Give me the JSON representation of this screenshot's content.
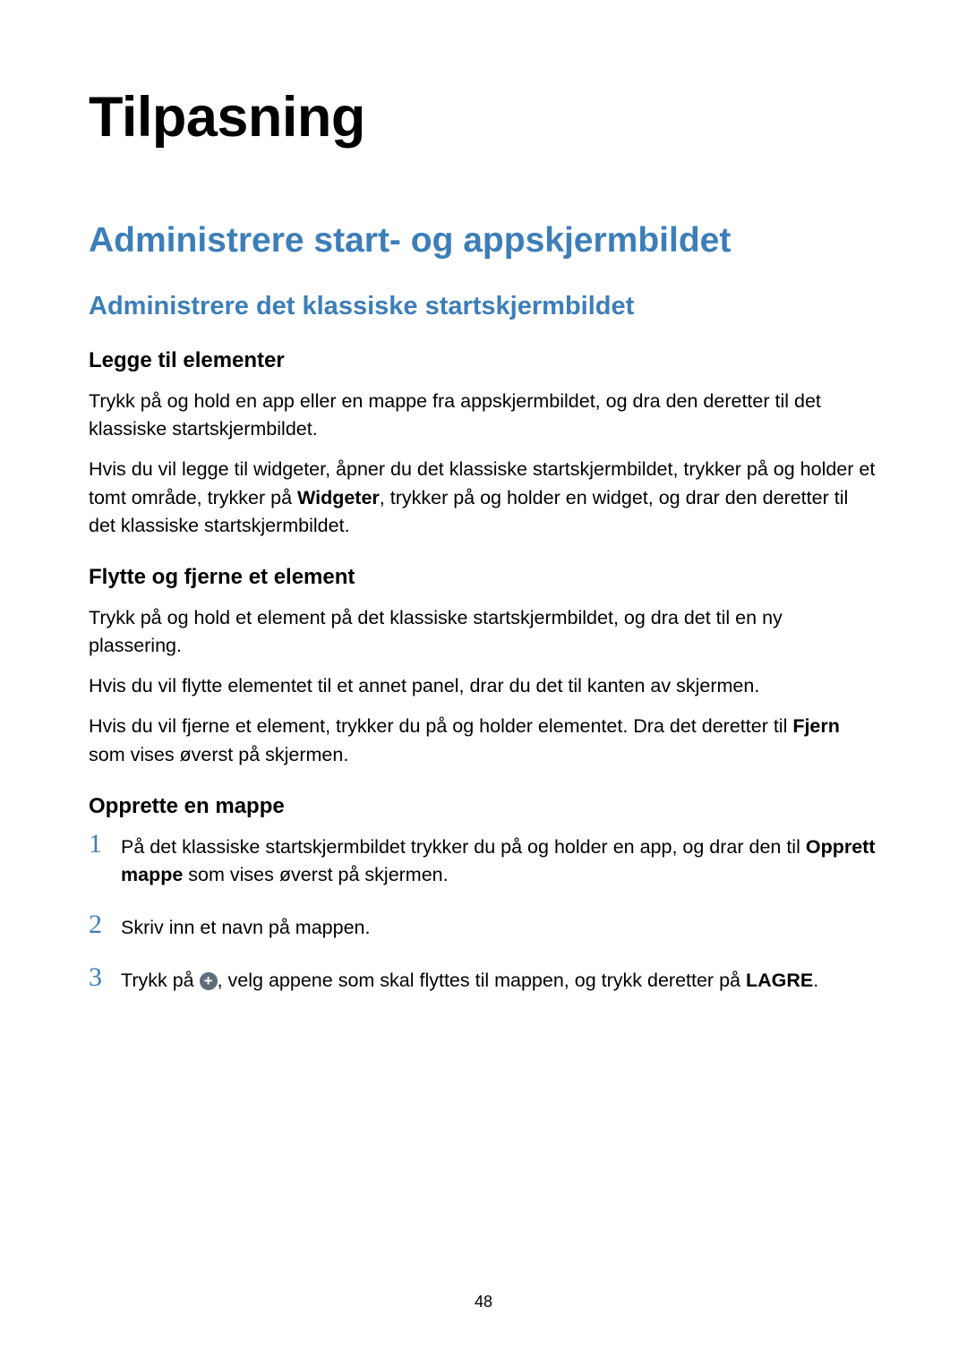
{
  "page": {
    "h1": "Tilpasning",
    "h2": "Administrere start- og appskjermbildet",
    "h3": "Administrere det klassiske startskjermbildet",
    "section1": {
      "h4": "Legge til elementer",
      "p1": "Trykk på og hold en app eller en mappe fra appskjermbildet, og dra den deretter til det klassiske startskjermbildet.",
      "p2a": "Hvis du vil legge til widgeter, åpner du det klassiske startskjermbildet, trykker på og holder et tomt område, trykker på ",
      "p2bold": "Widgeter",
      "p2b": ", trykker på og holder en widget, og drar den deretter til det klassiske startskjermbildet."
    },
    "section2": {
      "h4": "Flytte og fjerne et element",
      "p1": "Trykk på og hold et element på det klassiske startskjermbildet, og dra det til en ny plassering.",
      "p2": "Hvis du vil flytte elementet til et annet panel, drar du det til kanten av skjermen.",
      "p3a": "Hvis du vil fjerne et element, trykker du på og holder elementet. Dra det deretter til ",
      "p3bold": "Fjern",
      "p3b": " som vises øverst på skjermen."
    },
    "section3": {
      "h4": "Opprette en mappe",
      "step1_num": "1",
      "step1a": "På det klassiske startskjermbildet trykker du på og holder en app, og drar den til ",
      "step1bold": "Opprett mappe",
      "step1b": " som vises øverst på skjermen.",
      "step2_num": "2",
      "step2": "Skriv inn et navn på mappen.",
      "step3_num": "3",
      "step3a": "Trykk på ",
      "step3b": ", velg appene som skal flyttes til mappen, og trykk deretter på ",
      "step3bold": "LAGRE",
      "step3c": "."
    },
    "pagenum": "48"
  }
}
